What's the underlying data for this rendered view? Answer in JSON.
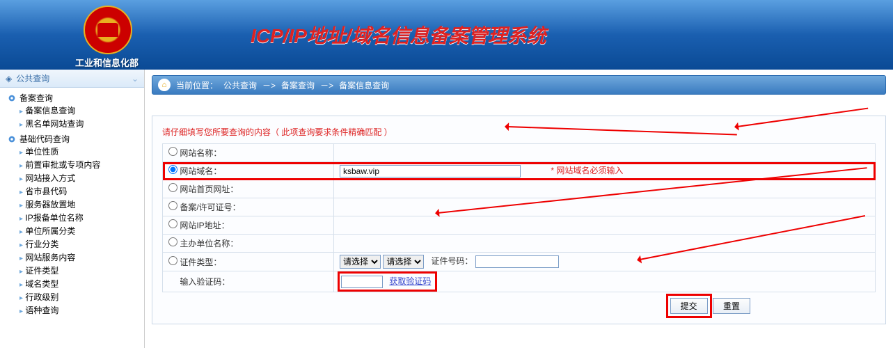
{
  "header": {
    "org": "工业和信息化部",
    "title": "ICP/IP地址/域名信息备案管理系统"
  },
  "sidebar": {
    "panel_title": "公共查询",
    "groups": [
      {
        "label": "备案查询",
        "items": [
          "备案信息查询",
          "黑名单网站查询"
        ]
      },
      {
        "label": "基础代码查询",
        "items": [
          "单位性质",
          "前置审批或专项内容",
          "网站接入方式",
          "省市县代码",
          "服务器放置地",
          "IP报备单位名称",
          "单位所属分类",
          "行业分类",
          "网站服务内容",
          "证件类型",
          "域名类型",
          "行政级别",
          "语种查询"
        ]
      }
    ]
  },
  "breadcrumb": {
    "label": "当前位置：",
    "p1": "公共查询",
    "sep": "－>",
    "p2": "备案查询",
    "p3": "备案信息查询"
  },
  "form": {
    "instruction": "请仔细填写您所要查询的内容（ 此项查询要求条件精确匹配 ）",
    "rows": [
      {
        "label": "网站名称："
      },
      {
        "label": "网站域名：",
        "value": "ksbaw.vip",
        "hint": "* 网站域名必须输入"
      },
      {
        "label": "网站首页网址："
      },
      {
        "label": "备案/许可证号："
      },
      {
        "label": "网站IP地址："
      },
      {
        "label": "主办单位名称："
      },
      {
        "label": "证件类型：",
        "select1": "请选择",
        "select2": "请选择",
        "extra_label": "证件号码："
      },
      {
        "label": "输入验证码：",
        "link": "获取验证码"
      }
    ],
    "submit": "提交",
    "reset": "重置"
  }
}
